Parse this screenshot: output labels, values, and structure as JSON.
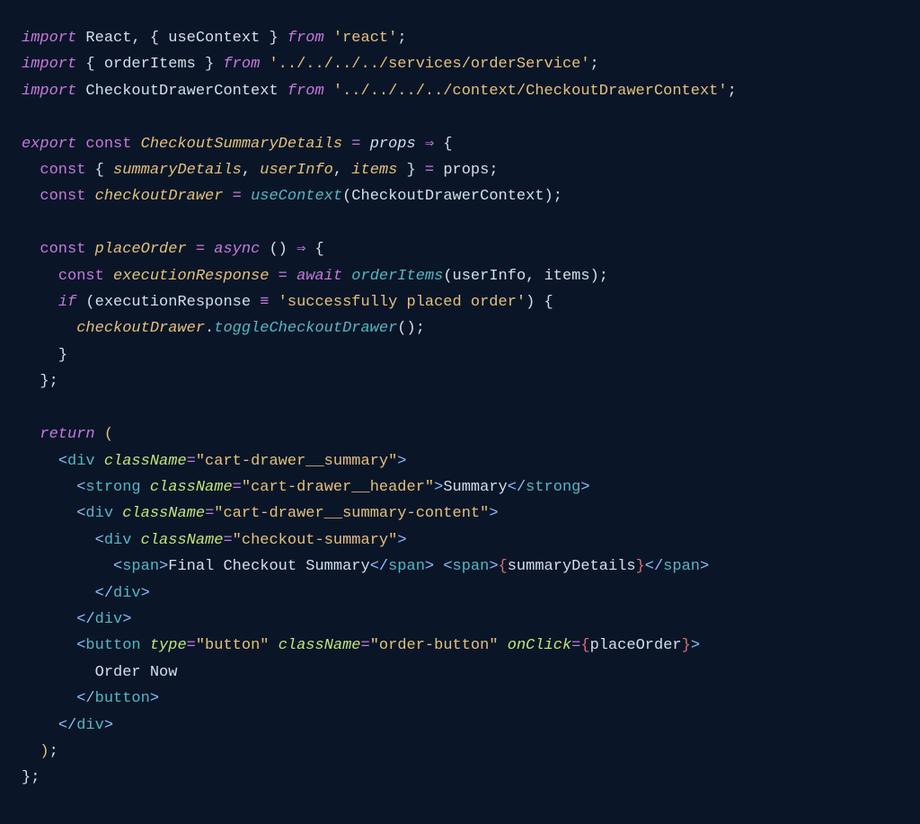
{
  "code": {
    "l1": {
      "import": "import",
      "React": "React",
      "useContext": "useContext",
      "from": "from",
      "react": "'react'"
    },
    "l2": {
      "import": "import",
      "orderItems": "orderItems",
      "from": "from",
      "path": "'../../../../services/orderService'"
    },
    "l3": {
      "import": "import",
      "CheckoutDrawerContext": "CheckoutDrawerContext",
      "from": "from",
      "path": "'../../../../context/CheckoutDrawerContext'"
    },
    "l5": {
      "export": "export",
      "const": "const",
      "name": "CheckoutSummaryDetails",
      "props": "props"
    },
    "l6": {
      "const": "const",
      "summaryDetails": "summaryDetails",
      "userInfo": "userInfo",
      "items": "items",
      "props": "props"
    },
    "l7": {
      "const": "const",
      "checkoutDrawer": "checkoutDrawer",
      "useContext": "useContext",
      "arg": "CheckoutDrawerContext"
    },
    "l9": {
      "const": "const",
      "placeOrder": "placeOrder",
      "async": "async"
    },
    "l10": {
      "const": "const",
      "executionResponse": "executionResponse",
      "await": "await",
      "orderItems": "orderItems",
      "userInfo": "userInfo",
      "items": "items"
    },
    "l11": {
      "if": "if",
      "executionResponse": "executionResponse",
      "str": "'successfully placed order'"
    },
    "l12": {
      "checkoutDrawer": "checkoutDrawer",
      "toggleCheckoutDrawer": "toggleCheckoutDrawer"
    },
    "l16": {
      "return": "return"
    },
    "l17": {
      "div": "div",
      "className": "className",
      "val": "\"cart-drawer__summary\""
    },
    "l18": {
      "strong": "strong",
      "className": "className",
      "val": "\"cart-drawer__header\"",
      "text": "Summary"
    },
    "l19": {
      "div": "div",
      "className": "className",
      "val": "\"cart-drawer__summary-content\""
    },
    "l20": {
      "div": "div",
      "className": "className",
      "val": "\"checkout-summary\""
    },
    "l21": {
      "span": "span",
      "text1": "Final Checkout Summary",
      "summaryDetails": "summaryDetails"
    },
    "l22": {
      "div": "div"
    },
    "l23": {
      "div": "div"
    },
    "l24": {
      "button": "button",
      "type": "type",
      "typeVal": "\"button\"",
      "className": "className",
      "classVal": "\"order-button\"",
      "onClick": "onClick",
      "placeOrder": "placeOrder"
    },
    "l25": {
      "text": "Order Now"
    },
    "l26": {
      "button": "button"
    },
    "l27": {
      "div": "div"
    }
  }
}
